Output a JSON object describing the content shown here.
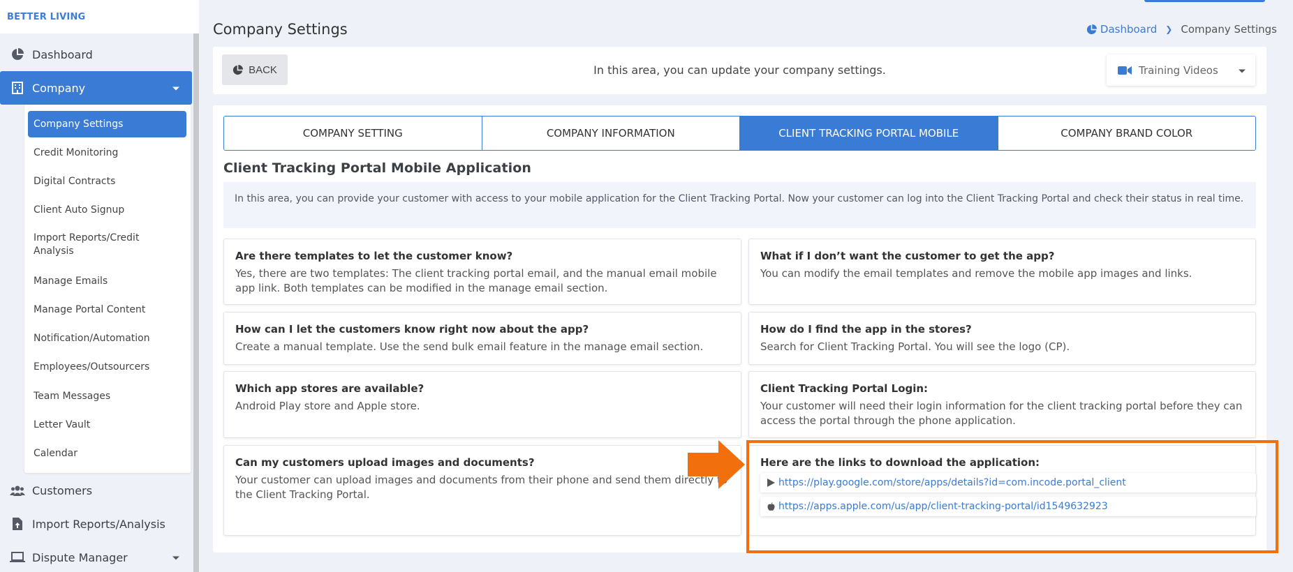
{
  "sidebar": {
    "brand": "BETTER LIVING",
    "items": {
      "dashboard": "Dashboard",
      "company": "Company",
      "customers": "Customers",
      "import_reports": "Import Reports/Analysis",
      "dispute_manager": "Dispute Manager"
    },
    "submenu": [
      "Company Settings",
      "Credit Monitoring",
      "Digital Contracts",
      "Client Auto Signup",
      "Import Reports/Credit Analysis",
      "Manage Emails",
      "Manage Portal Content",
      "Notification/Automation",
      "Employees/Outsourcers",
      "Team Messages",
      "Letter Vault",
      "Calendar"
    ]
  },
  "header": {
    "title": "Company Settings",
    "breadcrumb": {
      "home": "Dashboard",
      "current": "Company Settings"
    }
  },
  "topbar": {
    "back_label": "BACK",
    "info": "In this area, you can update your company settings.",
    "videos_label": "Training Videos"
  },
  "tabs": [
    "COMPANY SETTING",
    "COMPANY INFORMATION",
    "CLIENT TRACKING PORTAL MOBILE",
    "COMPANY BRAND COLOR"
  ],
  "section": {
    "title": "Client Tracking Portal Mobile Application",
    "banner": "In this area, you can provide your customer with access to your mobile application for the Client Tracking Portal. Now your customer can log into the Client Tracking Portal and check their status in real time."
  },
  "faqs": [
    {
      "q": "Are there templates to let the customer know?",
      "a": "Yes, there are two templates: The client tracking portal email, and the manual email mobile app link. Both templates can be modified in the manage email section."
    },
    {
      "q": "What if I don’t want the customer to get the app?",
      "a": "You can modify the email templates and remove the mobile app images and links."
    },
    {
      "q": "How can I let the customers know right now about the app?",
      "a": "Create a manual template. Use the send bulk email feature in the manage email section."
    },
    {
      "q": "How do I find the app in the stores?",
      "a": "Search for Client Tracking Portal. You will see the logo (CP)."
    },
    {
      "q": "Which app stores are available?",
      "a": "Android Play store and Apple store."
    },
    {
      "q": "Client Tracking Portal Login:",
      "a": "Your customer will need their login information for the client tracking portal before they can access the portal through the phone application."
    },
    {
      "q": "Can my customers upload images and documents?",
      "a": "Your customer can upload images and documents from their phone and send them directly to the Client Tracking Portal."
    },
    {
      "q": "Here are the links to download the application:",
      "a": ""
    }
  ],
  "links": {
    "android": "https://play.google.com/store/apps/details?id=com.incode.portal_client",
    "apple": "https://apps.apple.com/us/app/client-tracking-portal/id1549632923"
  },
  "colors": {
    "accent": "#3a7bd5",
    "highlight": "#f26f0d"
  }
}
